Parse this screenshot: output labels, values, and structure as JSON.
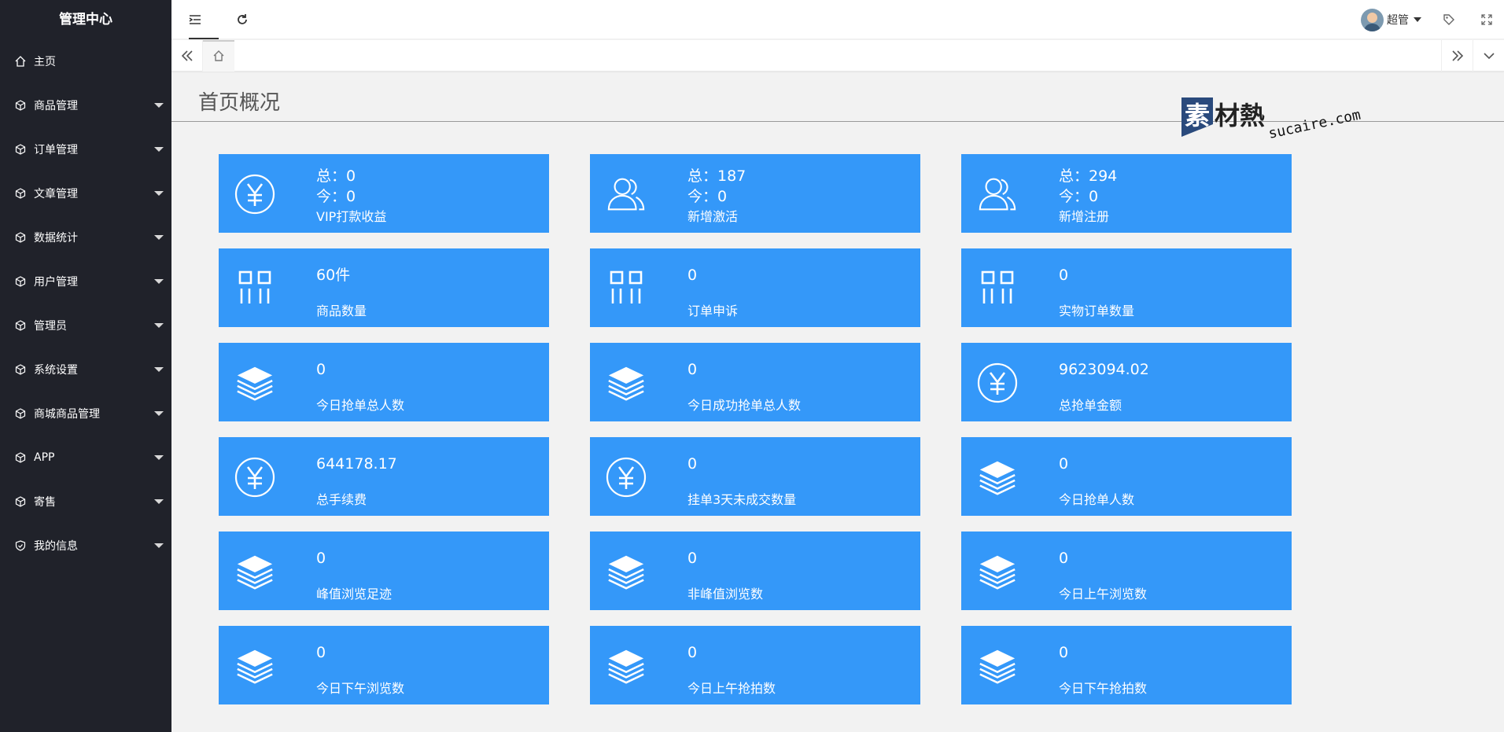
{
  "app": {
    "title": "管理中心"
  },
  "sidebar": {
    "items": [
      {
        "label": "主页",
        "icon": "home-icon"
      },
      {
        "label": "商品管理",
        "icon": "cube-icon"
      },
      {
        "label": "订单管理",
        "icon": "cube-icon"
      },
      {
        "label": "文章管理",
        "icon": "cube-icon"
      },
      {
        "label": "数据统计",
        "icon": "cube-icon"
      },
      {
        "label": "用户管理",
        "icon": "cube-icon"
      },
      {
        "label": "管理员",
        "icon": "cube-icon"
      },
      {
        "label": "系统设置",
        "icon": "cube-icon"
      },
      {
        "label": "商城商品管理",
        "icon": "cube-icon"
      },
      {
        "label": "APP",
        "icon": "cube-icon"
      },
      {
        "label": "寄售",
        "icon": "cube-icon"
      },
      {
        "label": "我的信息",
        "icon": "shield-check-icon"
      }
    ]
  },
  "header": {
    "user_name": "超管"
  },
  "page": {
    "title": "首页概况"
  },
  "watermark": {
    "brand": "素材熱",
    "domain": "sucaire.com"
  },
  "colors": {
    "sidebar_bg": "#20222a",
    "card_bg": "#3498f9",
    "page_bg": "#f2f2f2"
  },
  "cards": [
    {
      "icon": "yuan-circle-icon",
      "total": "总：0",
      "today": "今：0",
      "label": "VIP打款收益"
    },
    {
      "icon": "users-icon",
      "total": "总：187",
      "today": "今：0",
      "label": "新增激活"
    },
    {
      "icon": "users-icon",
      "total": "总：294",
      "today": "今：0",
      "label": "新增注册"
    },
    {
      "icon": "grid-icon",
      "value": "60件",
      "label": "商品数量"
    },
    {
      "icon": "grid-icon",
      "value": "0",
      "label": "订单申诉"
    },
    {
      "icon": "grid-icon",
      "value": "0",
      "label": "实物订单数量"
    },
    {
      "icon": "layers-icon",
      "value": "0",
      "label": "今日抢单总人数"
    },
    {
      "icon": "layers-icon",
      "value": "0",
      "label": "今日成功抢单总人数"
    },
    {
      "icon": "yuan-circle-icon",
      "value": "9623094.02",
      "label": "总抢单金额"
    },
    {
      "icon": "yuan-circle-icon",
      "value": "644178.17",
      "label": "总手续费"
    },
    {
      "icon": "yuan-circle-icon",
      "value": "0",
      "label": "挂单3天未成交数量"
    },
    {
      "icon": "layers-icon",
      "value": "0",
      "label": "今日抢单人数"
    },
    {
      "icon": "layers-icon",
      "value": "0",
      "label": "峰值浏览足迹"
    },
    {
      "icon": "layers-icon",
      "value": "0",
      "label": "非峰值浏览数"
    },
    {
      "icon": "layers-icon",
      "value": "0",
      "label": "今日上午浏览数"
    },
    {
      "icon": "layers-icon",
      "value": "0",
      "label": "今日下午浏览数"
    },
    {
      "icon": "layers-icon",
      "value": "0",
      "label": "今日上午抢拍数"
    },
    {
      "icon": "layers-icon",
      "value": "0",
      "label": "今日下午抢拍数"
    }
  ]
}
